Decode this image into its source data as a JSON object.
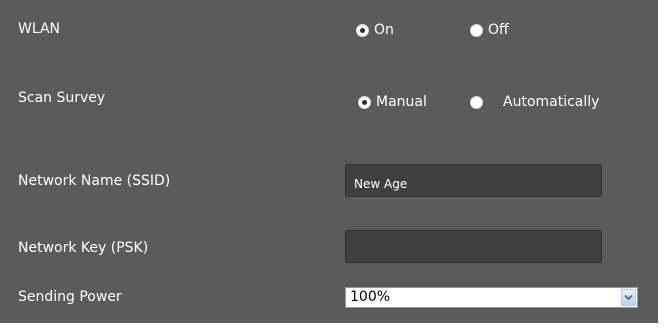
{
  "wlan": {
    "label": "WLAN",
    "options": [
      {
        "label": "On",
        "selected": true
      },
      {
        "label": "Off",
        "selected": false
      }
    ]
  },
  "scan_survey": {
    "label": "Scan Survey",
    "options": [
      {
        "label": "Manual",
        "selected": true
      },
      {
        "label": "Automatically",
        "selected": false
      }
    ]
  },
  "network_name": {
    "label": "Network Name (SSID)",
    "value": "New Age"
  },
  "network_key": {
    "label": "Network Key (PSK)",
    "value": ""
  },
  "sending_power": {
    "label": "Sending Power",
    "selected": "100%",
    "dropdown_icon": "chevron-down-icon"
  },
  "colors": {
    "panel_background": "#5b5b5b",
    "field_background": "#404040",
    "text": "#ffffff"
  }
}
